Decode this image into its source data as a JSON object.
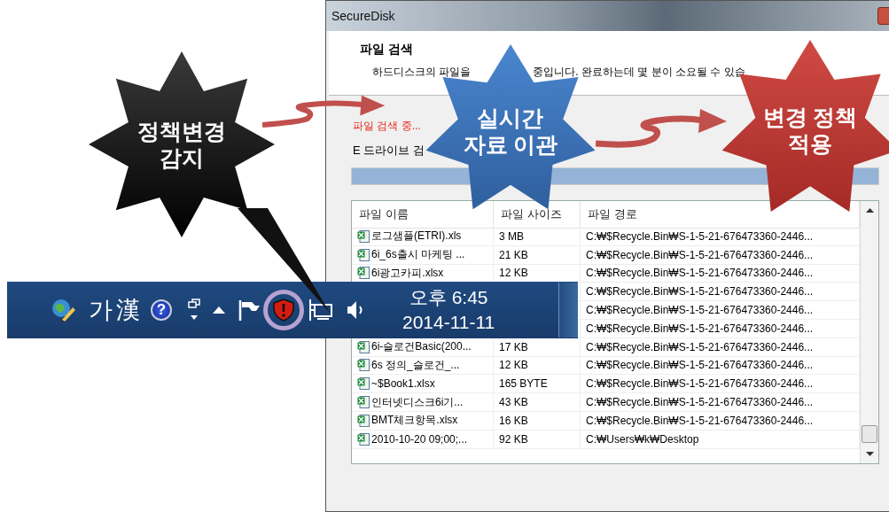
{
  "window": {
    "title": "SecureDisk"
  },
  "header": {
    "title": "파일 검색",
    "description_parts": [
      "하드디스크의 파일을",
      "중입니다. 완료하는데 몇 분이 소요될 수 있습"
    ]
  },
  "status": "파일 검색 중...",
  "drive_status": "E 드라이브 검",
  "progress": {
    "level": 1
  },
  "file_list": {
    "columns": [
      "파일 이름",
      "파일 사이즈",
      "파일 경로"
    ],
    "rows": [
      {
        "name": "로그샘플(ETRI).xls",
        "size": "3 MB",
        "path": "C:₩$Recycle.Bin₩S-1-5-21-676473360-2446..."
      },
      {
        "name": "6i_6s출시 마케팅 ...",
        "size": "21 KB",
        "path": "C:₩$Recycle.Bin₩S-1-5-21-676473360-2446..."
      },
      {
        "name": "6i광고카피.xlsx",
        "size": "12 KB",
        "path": "C:₩$Recycle.Bin₩S-1-5-21-676473360-2446..."
      },
      {
        "path": "C:₩$Recycle.Bin₩S-1-5-21-676473360-2446..."
      },
      {
        "path": "C:₩$Recycle.Bin₩S-1-5-21-676473360-2446..."
      },
      {
        "path": "C:₩$Recycle.Bin₩S-1-5-21-676473360-2446..."
      },
      {
        "name": "6i-슬로건Basic(200...",
        "size": "17 KB",
        "path": "C:₩$Recycle.Bin₩S-1-5-21-676473360-2446..."
      },
      {
        "name": "6s 정의_슬로건_...",
        "size": "12 KB",
        "path": "C:₩$Recycle.Bin₩S-1-5-21-676473360-2446..."
      },
      {
        "name": "~$Book1.xlsx",
        "size": "165 BYTE",
        "path": "C:₩$Recycle.Bin₩S-1-5-21-676473360-2446..."
      },
      {
        "name": "인터넷디스크6i기...",
        "size": "43 KB",
        "path": "C:₩$Recycle.Bin₩S-1-5-21-676473360-2446..."
      },
      {
        "name": "BMT체크항목.xlsx",
        "size": "16 KB",
        "path": "C:₩$Recycle.Bin₩S-1-5-21-676473360-2446..."
      },
      {
        "name": "2010-10-20 09;00;...",
        "size": "92 KB",
        "path": "C:₩Users₩k₩Desktop"
      }
    ]
  },
  "taskbar": {
    "ime": [
      "가",
      "漢"
    ],
    "help": "?",
    "time": "오후 6:45",
    "date": "2014-11-11"
  },
  "callouts": [
    {
      "kind": "black",
      "text": "정책변경\n감지"
    },
    {
      "kind": "blue",
      "text": "실시간\n자료 이관"
    },
    {
      "kind": "red",
      "text": "변경 정책\n적용"
    }
  ]
}
